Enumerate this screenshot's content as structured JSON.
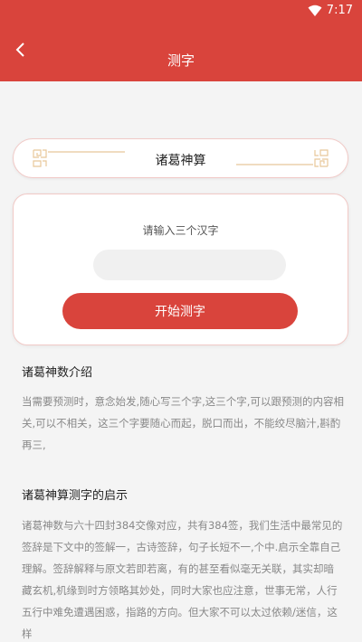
{
  "status_bar": {
    "time": "7:17",
    "wifi_icon": "wifi-icon"
  },
  "app_bar": {
    "title": "测字",
    "back_icon": "chevron-left-icon"
  },
  "banner": {
    "title": "诸葛神算"
  },
  "form": {
    "hint": "请输入三个汉字",
    "input_value": "",
    "input_placeholder": "",
    "submit_label": "开始测字"
  },
  "sections": [
    {
      "title": "诸葛神数介绍",
      "body": "当需要预测时，意念始发,随心写三个字,这三个字,可以跟预测的内容相关,可以不相关，这三个字要随心而起，脱口而出，不能绞尽脑汁,斟酌再三,"
    },
    {
      "title": "诸葛神算测字的启示",
      "body": "诸葛神数与六十四封384交像对应，共有384签，我们生活中最常见的签辞是下文中的签解一，古诗签辞，句子长短不一,个中.启示全靠自己理解。签辞解释与原文若即若离，有的甚至看似毫无关联，其实却暗藏玄机,机缘到时方领略其妙处，同时大家也应注意，世事无常，人行五行中难免遭遇困惑，指路的方向。但大家不可以太过依赖/迷信，这样"
    }
  ],
  "colors": {
    "accent": "#d9443c",
    "border": "#f1c9c6"
  }
}
